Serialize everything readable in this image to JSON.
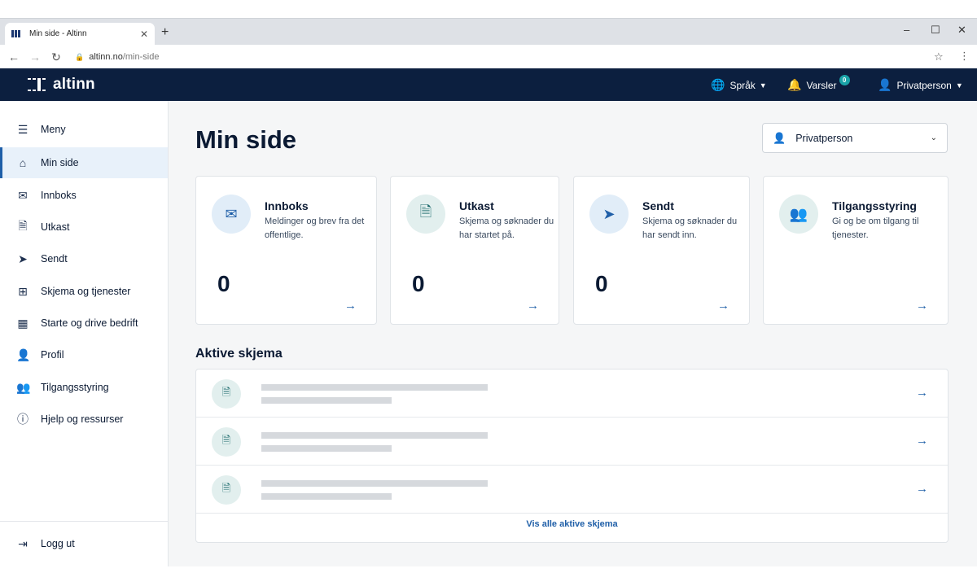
{
  "browser": {
    "tab_title": "Min side - Altinn",
    "tab_close": "✕",
    "new_tab": "+",
    "url_domain": "altinn.no",
    "url_path": "/min-side",
    "window_controls": [
      "–",
      "☐",
      "✕"
    ]
  },
  "header": {
    "logo_text": "altinn",
    "language": "Språk",
    "notifications": "Varsler",
    "notifications_count": "0",
    "profile": "Privatperson"
  },
  "sidebar": {
    "items": [
      {
        "label": "Meny",
        "icon": "menu-icon"
      },
      {
        "label": "Min side",
        "icon": "home-icon"
      },
      {
        "label": "Innboks",
        "icon": "mail-icon"
      },
      {
        "label": "Utkast",
        "icon": "document-icon"
      },
      {
        "label": "Sendt",
        "icon": "send-icon"
      },
      {
        "label": "Skjema og tjenester",
        "icon": "grid-icon"
      },
      {
        "label": "Starte og drive bedrift",
        "icon": "building-icon"
      },
      {
        "label": "Profil",
        "icon": "person-icon"
      },
      {
        "label": "Tilgangsstyring",
        "icon": "people-icon"
      },
      {
        "label": "Hjelp og ressurser",
        "icon": "help-icon"
      }
    ],
    "logout": "Logg ut"
  },
  "main": {
    "title": "Min side",
    "actor_select": "Privatperson",
    "cards": [
      {
        "title": "Innboks",
        "description": "Meldinger og brev fra det offentlige.",
        "count": "0",
        "icon": "mail-icon"
      },
      {
        "title": "Utkast",
        "description": "Skjema og søknader du har startet på.",
        "count": "0",
        "icon": "document-icon"
      },
      {
        "title": "Sendt",
        "description": "Skjema og søknader du har sendt inn.",
        "count": "0",
        "icon": "send-icon"
      },
      {
        "title": "Tilgangsstyring",
        "description": "Gi og be om tilgang til tjenester.",
        "count": "",
        "icon": "people-icon"
      }
    ],
    "active_forms_title": "Aktive skjema",
    "show_all": "Vis alle aktive skjema"
  },
  "colors": {
    "header_bg": "#0c1f3f",
    "accent": "#1f5fa8",
    "badge": "#1aa3a8",
    "teal_circle": "#e2efee",
    "blue_circle": "#e1edf8"
  }
}
